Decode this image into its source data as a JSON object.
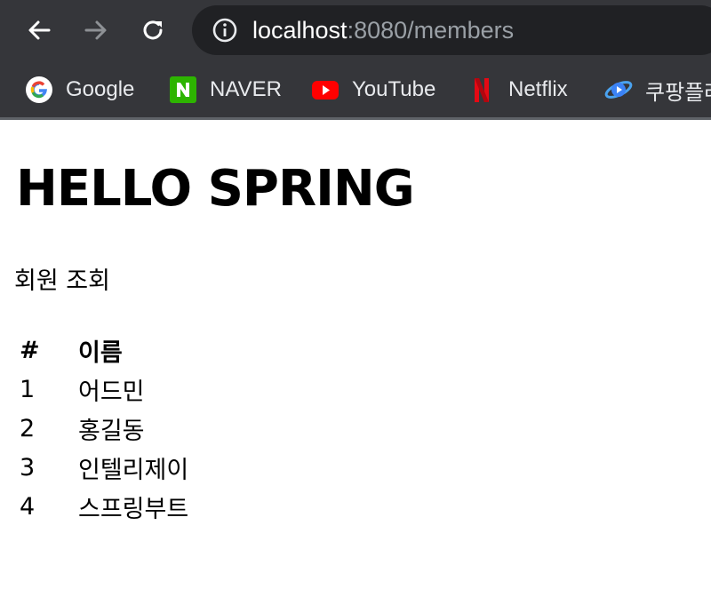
{
  "browser": {
    "url_host": "localhost",
    "url_path": ":8080/members",
    "bookmarks": [
      {
        "label": "Google",
        "icon": "google-icon"
      },
      {
        "label": "NAVER",
        "icon": "naver-icon"
      },
      {
        "label": "YouTube",
        "icon": "youtube-icon"
      },
      {
        "label": "Netflix",
        "icon": "netflix-icon"
      },
      {
        "label": "쿠팡플레",
        "icon": "coupang-play-icon"
      }
    ],
    "colors": {
      "toolbar": "#35363a",
      "omnibox": "#202124"
    }
  },
  "page": {
    "title": "HELLO SPRING",
    "subtitle": "회원 조회",
    "table": {
      "headers": [
        "#",
        "이름"
      ],
      "rows": [
        {
          "id": "1",
          "name": "어드민"
        },
        {
          "id": "2",
          "name": "홍길동"
        },
        {
          "id": "3",
          "name": "인텔리제이"
        },
        {
          "id": "4",
          "name": "스프링부트"
        }
      ]
    }
  }
}
